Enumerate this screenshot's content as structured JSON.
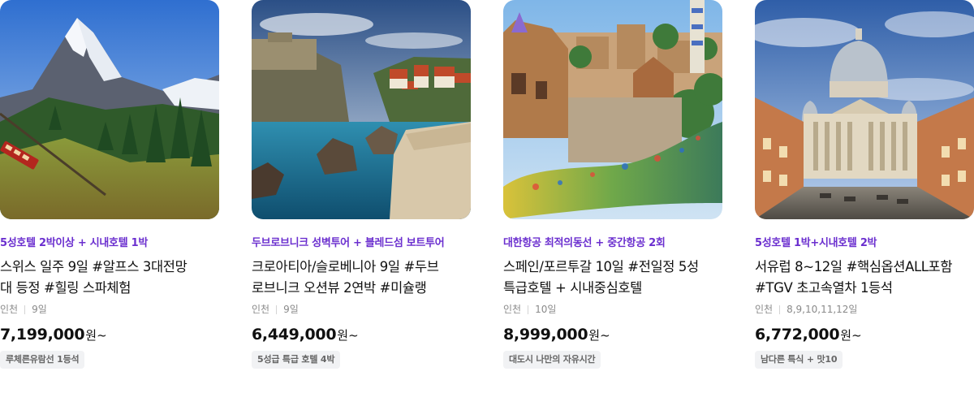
{
  "products": [
    {
      "promo": "5성호텔 2박이상 + 시내호텔 1박",
      "title_line1": "스위스 일주 9일 #알프스 3대전망",
      "title_line2": "대 등정 #힐링 스파체험",
      "departure": "인천",
      "duration": "9일",
      "price": "7,199,000",
      "currency": "원~",
      "tag": "루체른유람선 1등석",
      "image_alt": "matterhorn-mountain-train"
    },
    {
      "promo": "두브로브니크 성벽투어 + 블레드섬 보트투어",
      "title_line1": "크로아티아/슬로베니아 9일 #두브",
      "title_line2": "로브니크 오션뷰 2연박 #미슐랭",
      "departure": "인천",
      "duration": "9일",
      "price": "6,449,000",
      "currency": "원~",
      "tag": "5성급 특급 호텔 4박",
      "image_alt": "dubrovnik-coast-walls"
    },
    {
      "promo": "대한항공 최적의동선 + 중간항공 2회",
      "title_line1": "스페인/포르투갈 10일 #전일정 5성",
      "title_line2": "특급호텔 + 시내중심호텔",
      "departure": "인천",
      "duration": "10일",
      "price": "8,999,000",
      "currency": "원~",
      "tag": "대도시 나만의 자유시간",
      "image_alt": "park-guell-barcelona"
    },
    {
      "promo": "5성호텔 1박+시내호텔 2박",
      "title_line1": "서유럽 8~12일 #핵심옵션ALL포함",
      "title_line2": "#TGV 초고속열차 1등석",
      "departure": "인천",
      "duration": "8,9,10,11,12일",
      "price": "6,772,000",
      "currency": "원~",
      "tag": "남다른 특식 + 맛10",
      "image_alt": "st-peters-basilica-vatican"
    }
  ]
}
